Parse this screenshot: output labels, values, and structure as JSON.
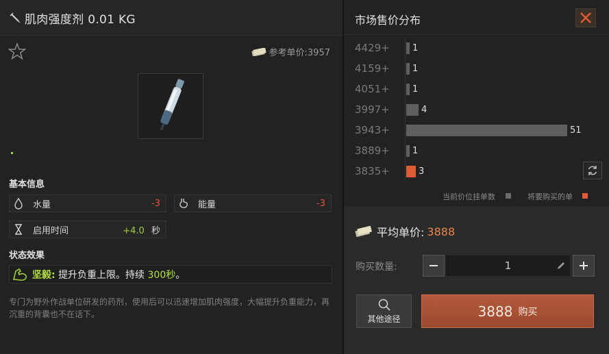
{
  "item": {
    "title": "肌肉强度剂 0.01 KG",
    "ref_price_label": "参考单价:3957",
    "rarity_color": "#9fd23e"
  },
  "basic_info": {
    "heading": "基本信息",
    "water_label": "水量",
    "water_value": "-3",
    "energy_label": "能量",
    "energy_value": "-3",
    "use_time_label": "启用时间",
    "use_time_value": "+4.0",
    "use_time_unit": "秒"
  },
  "status_effect": {
    "heading": "状态效果",
    "name": "坚毅:",
    "text_before": "提升负重上限。持续",
    "duration": "300秒",
    "text_after": "。"
  },
  "description": "专门为野外作战单位研发的药剂，使用后可以迅速增加肌肉强度，大幅提升负重能力，再沉重的背囊也不在话下。",
  "market": {
    "title": "市场售价分布",
    "legend_current": "当前价位挂单数",
    "legend_mine": "将要购买的单",
    "rows": [
      {
        "price": "4429+",
        "count": "1"
      },
      {
        "price": "4159+",
        "count": "1"
      },
      {
        "price": "4051+",
        "count": "1"
      },
      {
        "price": "3997+",
        "count": "4"
      },
      {
        "price": "3943+",
        "count": "51"
      },
      {
        "price": "3889+",
        "count": "1"
      },
      {
        "price": "3835+",
        "count": "3"
      }
    ]
  },
  "chart_data": {
    "type": "bar",
    "categories": [
      "4429+",
      "4159+",
      "4051+",
      "3997+",
      "3943+",
      "3889+",
      "3835+"
    ],
    "values": [
      1,
      1,
      1,
      4,
      51,
      1,
      3
    ],
    "highlight_index": 6
  },
  "buy": {
    "avg_label": "平均单价:",
    "avg_value": "3888",
    "qty_label": "购买数量:",
    "qty_value": "1",
    "other_label": "其他途径",
    "buy_price": "3888",
    "buy_label": "购买"
  },
  "colors": {
    "accent": "#e05a35",
    "positive": "#9ed03d",
    "negative": "#e2543b"
  }
}
